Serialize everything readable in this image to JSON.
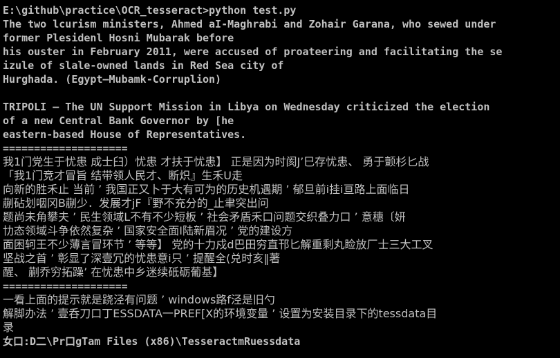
{
  "console": {
    "lines": [
      {
        "text": "E:\\github\\practice\\OCR_tesseract>python test.py",
        "cjk": false
      },
      {
        "text": "The two lcurism ministers, Ahmed aI-Maghrabi and Zohair Garana, who sewed under",
        "cjk": false
      },
      {
        "text": "former Plesidenl Hosni Mubarak before",
        "cjk": false
      },
      {
        "text": "his ouster in February 2011, were accused of proateering and facilitating the se",
        "cjk": false
      },
      {
        "text": "izule of slale-owned lands in Red Sea city of",
        "cjk": false
      },
      {
        "text": "Hurghada. (Egypt—Mubamk-Corruplion)",
        "cjk": false
      },
      {
        "text": "",
        "cjk": false
      },
      {
        "text": "TRIPOLI — The UN Support Mission in Libya on Wednesday criticized the election",
        "cjk": false
      },
      {
        "text": "of a new Central Bank Governor by [he",
        "cjk": false
      },
      {
        "text": "eastern-based House of Representatives.",
        "cjk": false
      },
      {
        "text": "====================",
        "cjk": false
      },
      {
        "text": "我1门党生于忧患 成士臼）忧患 才扶于忧患】 正是因为时阂J’巳存忧患、 勇于颤杉匕战",
        "cjk": true
      },
      {
        "text": "「我1门竞才冒旨 结带领人民才、断炽』生禾U走",
        "cjk": true
      },
      {
        "text": "向新的胜禾止 当前 ’ 我国正又卜于大有可为的历史机遇期 ’ 郁旦前i挂i亘路上面临日",
        "cjk": true
      },
      {
        "text": "蒯砧划咽冈B蒯少．发展才jF『野不充分的_止聿突出问",
        "cjk": true
      },
      {
        "text": "题尚未角攀夫 ’ 民生领域L不有不少短板 ’ 社会矛盾禾口问题交织叠力口 ’ 意穗〔妍",
        "cjk": true
      },
      {
        "text": "㔹态领域斗争依然复杂 ’ 国家安全面I陆新眉况 ’ 党的建设方",
        "cjk": true
      },
      {
        "text": "面困轲王不少薄言冒环节 ’ 等等】 党的十力戍d巴田穷直邗匕解重剩丸睑放厂士三大工叉",
        "cjk": true
      },
      {
        "text": "坚战之首 ’ 彰显了深壹冗的忧患意i只 ’ 提醒全(兑时亥‖著",
        "cjk": true
      },
      {
        "text": "醒、 蒯乔穷拓躁’ 在忧患中乡迷续砥砺葡基】",
        "cjk": true
      },
      {
        "text": "====================",
        "cjk": false
      },
      {
        "text": "一看上面的提示就是跷泾有问题 ’ windows路f泾是旧勺",
        "cjk": true
      },
      {
        "text": "解脚办法 ’ 壹呑刀口丁ESSDATA一PREF[X的环境变量 ’ 设置为安装目录下的tessdata目",
        "cjk": true
      },
      {
        "text": "录",
        "cjk": true
      },
      {
        "text": "女口:D二\\Pr口gTam Files (x86)\\TesseractmRuessdata",
        "cjk": false
      }
    ]
  }
}
